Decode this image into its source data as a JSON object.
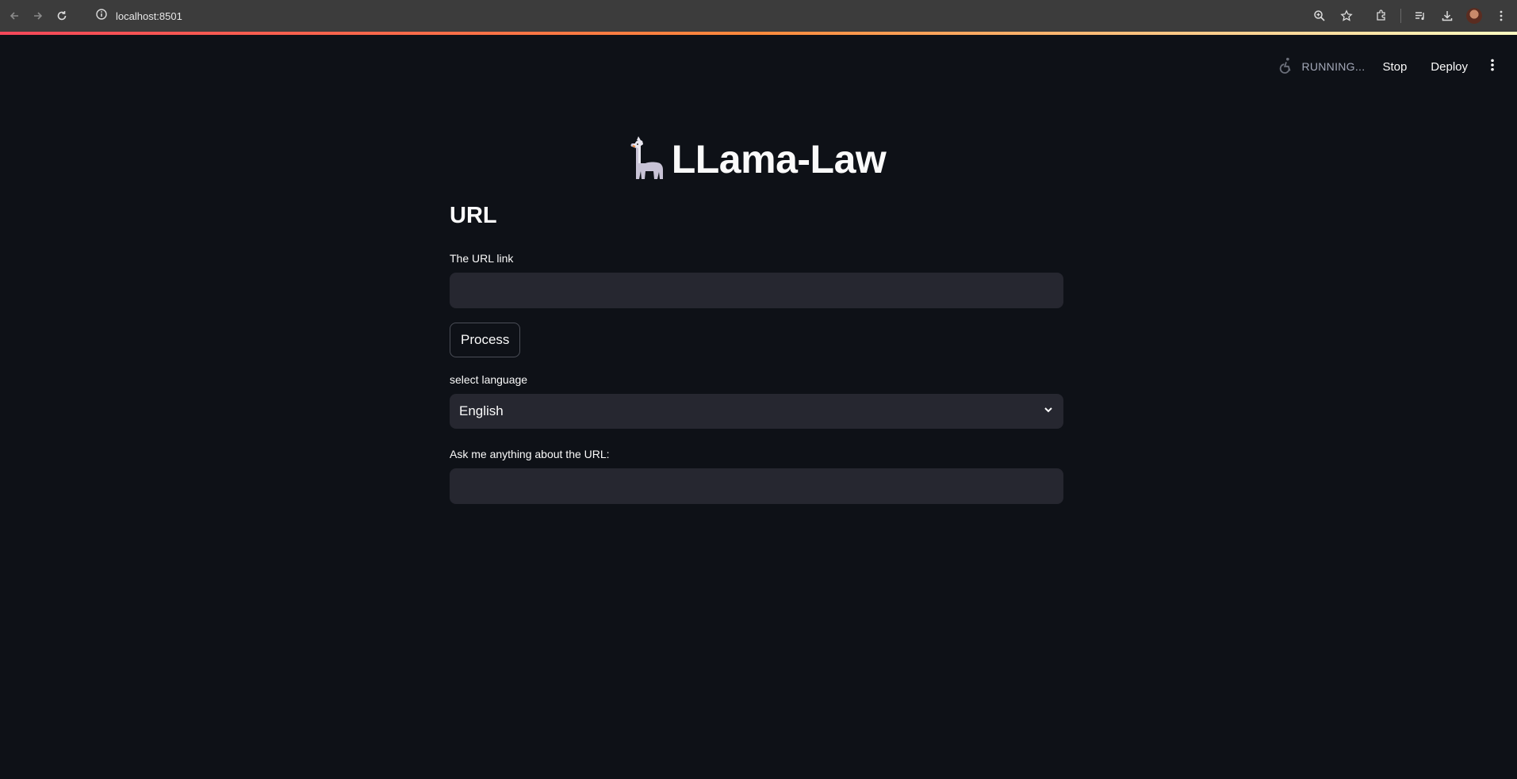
{
  "browser": {
    "url": "localhost:8501"
  },
  "header": {
    "status": "RUNNING...",
    "stop_label": "Stop",
    "deploy_label": "Deploy"
  },
  "app": {
    "title": "LLama-Law",
    "section_heading": "URL",
    "url_label": "The URL link",
    "url_value": "",
    "process_label": "Process",
    "language_label": "select language",
    "language_value": "English",
    "question_label": "Ask me anything about the URL:",
    "question_value": ""
  },
  "colors": {
    "background": "#0e1117",
    "input_background": "#262730",
    "chrome_bar": "#3c3c3c",
    "progress_gradient_start": "#f4475a",
    "progress_gradient_end": "#fffbc2"
  }
}
